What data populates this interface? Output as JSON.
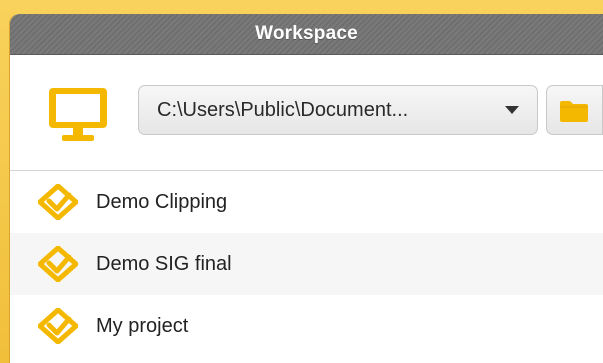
{
  "window": {
    "title": "Workspace"
  },
  "toolbar": {
    "workspace_icon": "monitor-icon",
    "path_dropdown": {
      "selected_value": "C:\\Users\\Public\\Document..."
    },
    "browse_icon": "folder-icon"
  },
  "projects": {
    "items": [
      {
        "label": "Demo Clipping",
        "icon": "project-icon"
      },
      {
        "label": "Demo SIG final",
        "icon": "project-icon"
      },
      {
        "label": "My project",
        "icon": "project-icon"
      }
    ]
  },
  "colors": {
    "accent": "#f5b800",
    "titlebar": "#767676",
    "frame": "#f4c84a"
  }
}
